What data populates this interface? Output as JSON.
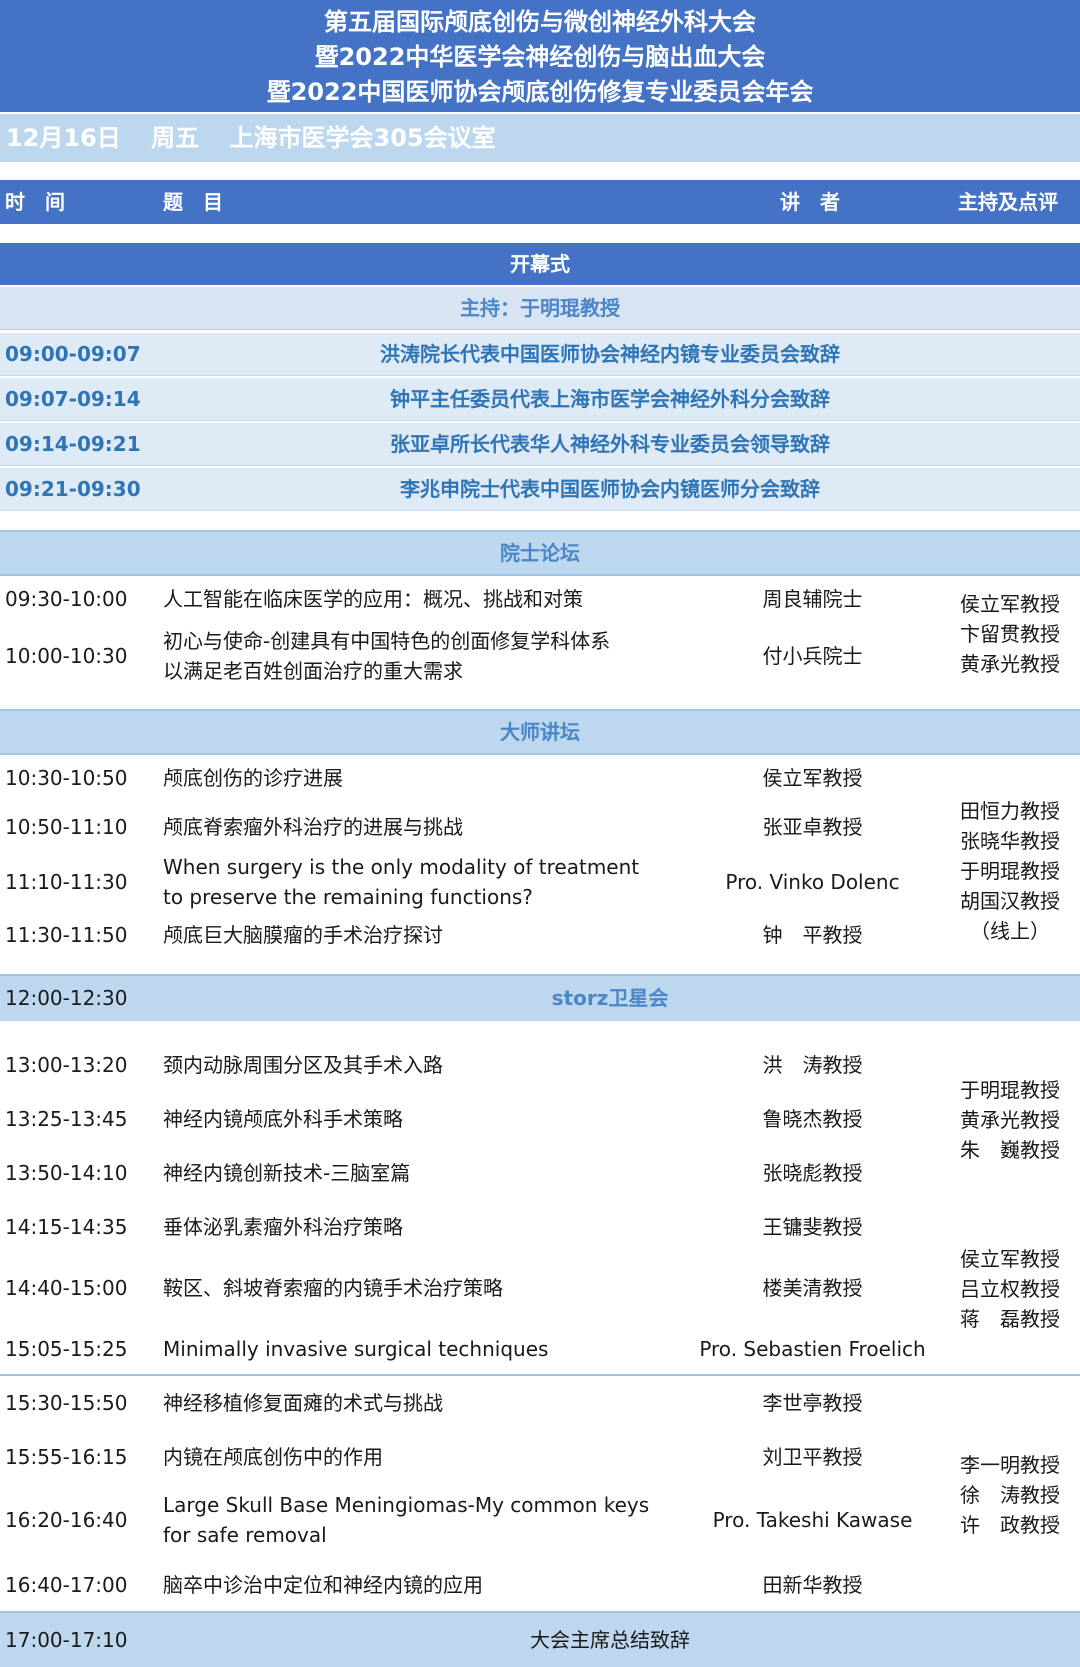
{
  "header": {
    "title_lines": [
      "第五届国际颅底创伤与微创神经外科大会",
      "暨2022中华医学会神经创伤与脑出血大会",
      "暨2022中国医师协会颅底创伤修复专业委员会年会"
    ],
    "date": "12月16日",
    "weekday": "周五",
    "venue": "上海市医学会305会议室"
  },
  "columns": {
    "time": "时　间",
    "topic": "题　目",
    "speaker": "讲　者",
    "moderator": "主持及点评"
  },
  "opening": {
    "title": "开幕式",
    "host": "主持：于明琨教授",
    "rows": [
      {
        "time": "09:00-09:07",
        "content": "洪涛院长代表中国医师协会神经内镜专业委员会致辞"
      },
      {
        "time": "09:07-09:14",
        "content": "钟平主任委员代表上海市医学会神经外科分会致辞"
      },
      {
        "time": "09:14-09:21",
        "content": "张亚卓所长代表华人神经外科专业委员会领导致辞"
      },
      {
        "time": "09:21-09:30",
        "content": "李兆申院士代表中国医师协会内镜医师分会致辞"
      }
    ]
  },
  "academician_forum": {
    "title": "院士论坛",
    "rows": [
      {
        "time": "09:30-10:00",
        "topic": "人工智能在临床医学的应用：概况、挑战和对策",
        "speaker": "周良辅院士"
      },
      {
        "time": "10:00-10:30",
        "topic_lines": [
          "初心与使命-创建具有中国特色的创面修复学科体系",
          "以满足老百姓创面治疗的重大需求"
        ],
        "speaker": "付小兵院士"
      }
    ],
    "moderators": [
      "侯立军教授",
      "卞留贯教授",
      "黄承光教授"
    ]
  },
  "master_forum": {
    "title": "大师讲坛",
    "rows": [
      {
        "time": "10:30-10:50",
        "topic": "颅底创伤的诊疗进展",
        "speaker": "侯立军教授"
      },
      {
        "time": "10:50-11:10",
        "topic": "颅底脊索瘤外科治疗的进展与挑战",
        "speaker": "张亚卓教授"
      },
      {
        "time": "11:10-11:30",
        "topic_lines": [
          "When surgery is the only modality of treatment",
          "to preserve the remaining functions?"
        ],
        "speaker": "Pro. Vinko Dolenc"
      },
      {
        "time": "11:30-11:50",
        "topic": "颅底巨大脑膜瘤的手术治疗探讨",
        "speaker": "钟　平教授"
      }
    ],
    "moderators": [
      "田恒力教授",
      "张晓华教授",
      "于明琨教授",
      "胡国汉教授",
      "（线上）"
    ]
  },
  "satellite": {
    "time": "12:00-12:30",
    "title": "storz卫星会"
  },
  "afternoon_1": {
    "rows": [
      {
        "time": "13:00-13:20",
        "topic": "颈内动脉周围分区及其手术入路",
        "speaker": "洪　涛教授"
      },
      {
        "time": "13:25-13:45",
        "topic": "神经内镜颅底外科手术策略",
        "speaker": "鲁晓杰教授"
      },
      {
        "time": "13:50-14:10",
        "topic": "神经内镜创新技术-三脑室篇",
        "speaker": "张晓彪教授"
      }
    ],
    "moderators": [
      "于明琨教授",
      "黄承光教授",
      "朱　巍教授"
    ]
  },
  "afternoon_2": {
    "rows": [
      {
        "time": "14:15-14:35",
        "topic": "垂体泌乳素瘤外科治疗策略",
        "speaker": "王镛斐教授"
      },
      {
        "time": "14:40-15:00",
        "topic": "鞍区、斜坡脊索瘤的内镜手术治疗策略",
        "speaker": "楼美清教授"
      },
      {
        "time": "15:05-15:25",
        "topic": "Minimally invasive surgical techniques",
        "speaker": "Pro. Sebastien Froelich"
      }
    ],
    "moderators": [
      "侯立军教授",
      "吕立权教授",
      "蒋　磊教授"
    ]
  },
  "afternoon_3": {
    "rows": [
      {
        "time": "15:30-15:50",
        "topic": "神经移植修复面瘫的术式与挑战",
        "speaker": "李世亭教授"
      },
      {
        "time": "15:55-16:15",
        "topic": "内镜在颅底创伤中的作用",
        "speaker": "刘卫平教授"
      },
      {
        "time": "16:20-16:40",
        "topic_lines": [
          "Large Skull Base Meningiomas-My common keys",
          "for safe removal"
        ],
        "speaker": "Pro. Takeshi Kawase"
      },
      {
        "time": "16:40-17:00",
        "topic": "脑卒中诊治中定位和神经内镜的应用",
        "speaker": "田新华教授"
      }
    ],
    "moderators": [
      "李一明教授",
      "徐　涛教授",
      "许　政教授"
    ]
  },
  "closing": {
    "time": "17:00-17:10",
    "title": "大会主席总结致辞"
  },
  "colors": {
    "primary": "#4472c4",
    "light": "#bdd7ee",
    "pale": "#deebf7",
    "accent_text": "#2f75b5"
  }
}
